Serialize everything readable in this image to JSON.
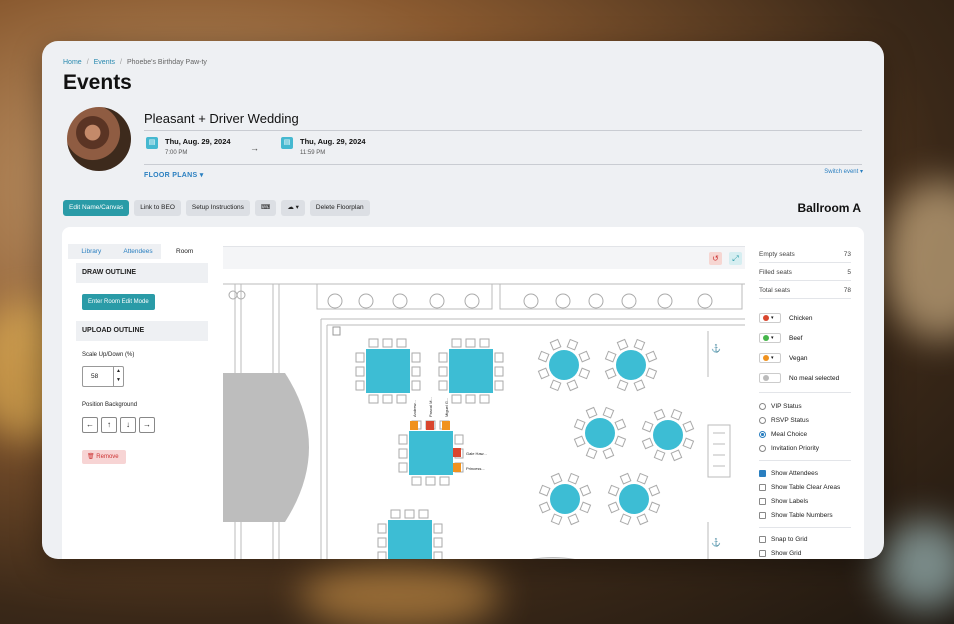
{
  "breadcrumb": [
    "Home",
    "Events",
    "Phoebe's Birthday Paw-ty"
  ],
  "page_title": "Events",
  "event": {
    "name": "Pleasant + Driver Wedding",
    "start": {
      "date": "Thu, Aug. 29, 2024",
      "time": "7:00 PM"
    },
    "end": {
      "date": "Thu, Aug. 29, 2024",
      "time": "11:59 PM"
    },
    "floor_plans_label": "FLOOR PLANS",
    "switch_label": "Switch event"
  },
  "toolbar": {
    "edit": "Edit Name/Canvas",
    "link": "Link to BEO",
    "setup": "Setup Instructions",
    "delete": "Delete Floorplan"
  },
  "room_name": "Ballroom A",
  "left_panel": {
    "tabs": [
      "Library",
      "Attendees",
      "Room"
    ],
    "draw_outline": "DRAW OUTLINE",
    "room_edit": "Enter Room Edit Mode",
    "upload_outline": "UPLOAD OUTLINE",
    "scale_label": "Scale Up/Down (%)",
    "scale_value": "58",
    "position_label": "Position Background",
    "remove": "Remove"
  },
  "canvas": {
    "seat_labels": [
      "Andrew...",
      "Pascal M...",
      "Miguel G..."
    ],
    "side_labels": [
      "Gale Haw...",
      "Princess..."
    ]
  },
  "stats": [
    {
      "label": "Empty seats",
      "value": "73"
    },
    {
      "label": "Filled seats",
      "value": "5"
    },
    {
      "label": "Total seats",
      "value": "78"
    }
  ],
  "meals": [
    {
      "label": "Chicken",
      "color": "#d9462e"
    },
    {
      "label": "Beef",
      "color": "#45b54a"
    },
    {
      "label": "Vegan",
      "color": "#f0921e"
    },
    {
      "label": "No meal selected",
      "color": "#bbbbbb"
    }
  ],
  "status_options": [
    "VIP Status",
    "RSVP Status",
    "Meal Choice",
    "Invitation Priority"
  ],
  "show_options": [
    "Show Attendees",
    "Show Table Clear Areas",
    "Show Labels",
    "Show Table Numbers"
  ],
  "grid_options": [
    "Snap to Grid",
    "Show Grid"
  ],
  "colors": {
    "teal": "#3dbdd4",
    "accent": "#2a9ba7",
    "link": "#2a7fc0"
  }
}
